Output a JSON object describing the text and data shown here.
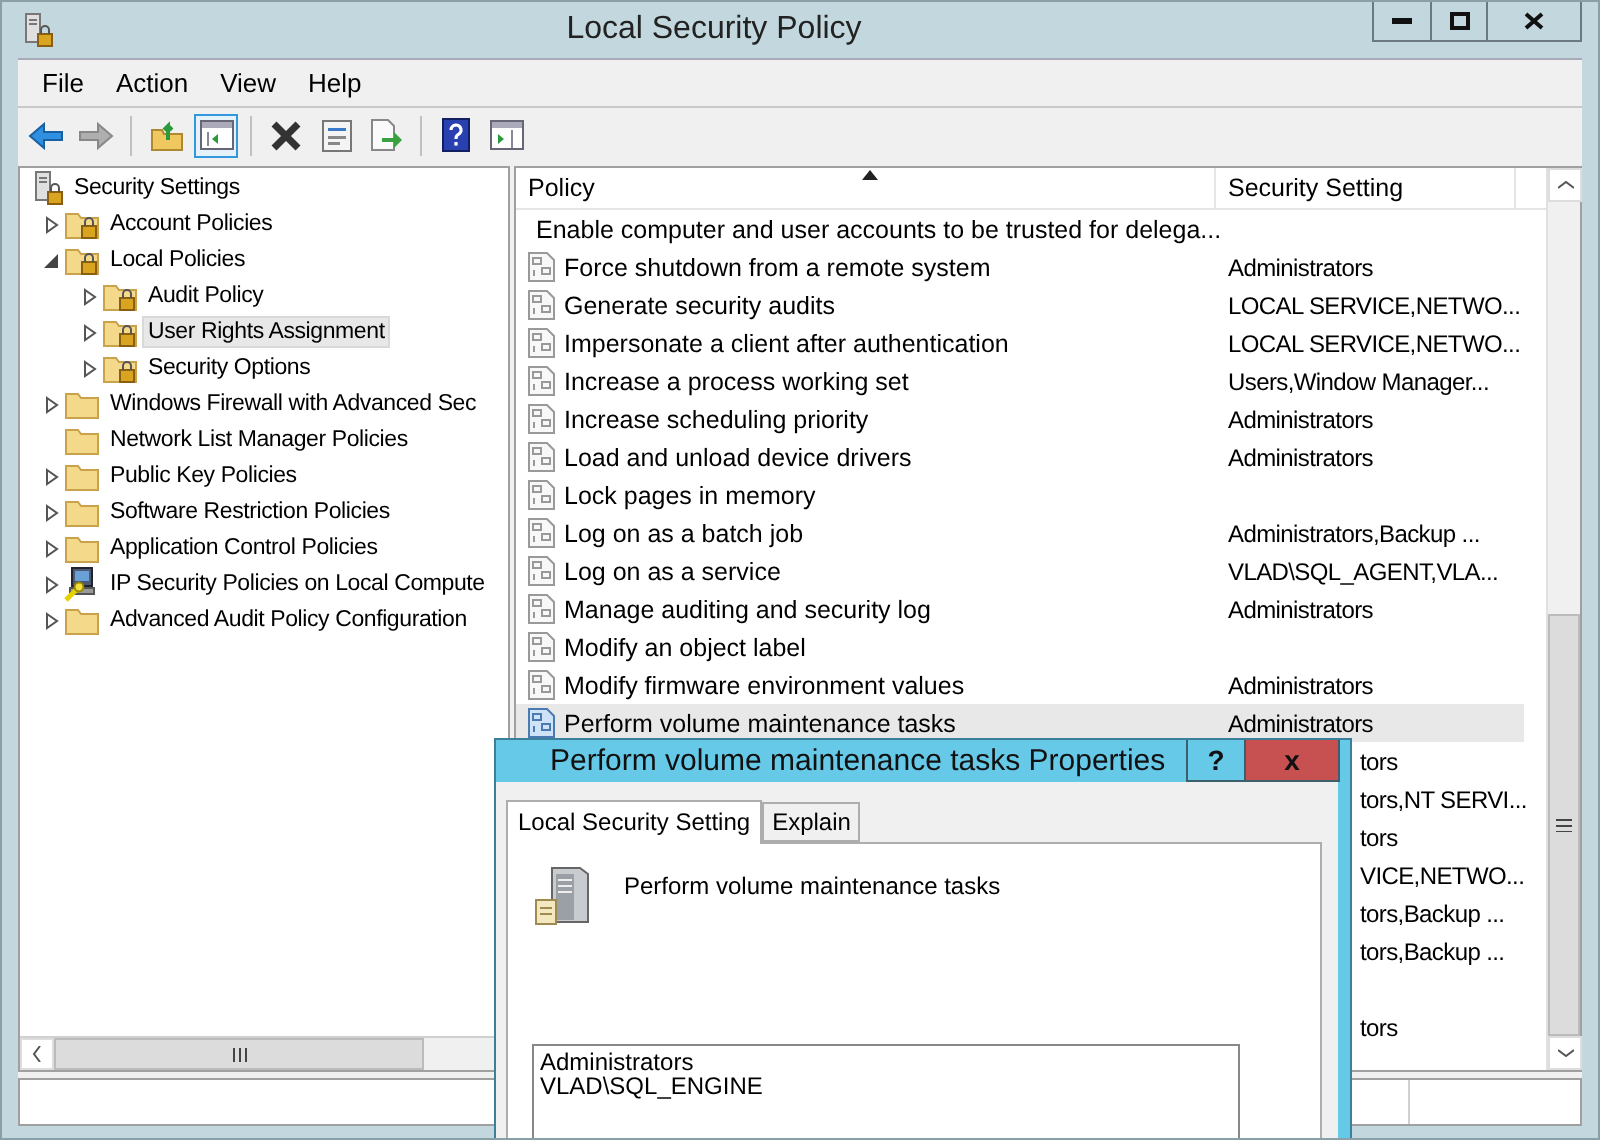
{
  "window": {
    "title": "Local Security Policy"
  },
  "menu": [
    "File",
    "Action",
    "View",
    "Help"
  ],
  "toolbar": [
    {
      "kind": "back",
      "disabled": false,
      "pressed": false
    },
    {
      "kind": "forward",
      "disabled": true,
      "pressed": false
    },
    {
      "kind": "sep"
    },
    {
      "kind": "up",
      "disabled": false,
      "pressed": false
    },
    {
      "kind": "tree",
      "disabled": false,
      "pressed": true
    },
    {
      "kind": "sep"
    },
    {
      "kind": "delete",
      "disabled": false,
      "pressed": false
    },
    {
      "kind": "properties",
      "disabled": false,
      "pressed": false
    },
    {
      "kind": "export",
      "disabled": false,
      "pressed": false
    },
    {
      "kind": "sep"
    },
    {
      "kind": "help",
      "disabled": false,
      "pressed": false
    },
    {
      "kind": "pane",
      "disabled": false,
      "pressed": false
    }
  ],
  "tree": {
    "label": "Security Settings",
    "kind": "security",
    "selected": false,
    "children": [
      {
        "label": "Account Policies",
        "kind": "locked",
        "expandable": true,
        "expanded": false,
        "selected": false
      },
      {
        "label": "Local Policies",
        "kind": "locked",
        "expandable": true,
        "expanded": true,
        "selected": false,
        "children": [
          {
            "label": "Audit Policy",
            "kind": "locked",
            "expandable": true,
            "expanded": false,
            "selected": false
          },
          {
            "label": "User Rights Assignment",
            "kind": "locked",
            "expandable": true,
            "expanded": false,
            "selected": true
          },
          {
            "label": "Security Options",
            "kind": "locked",
            "expandable": true,
            "expanded": false,
            "selected": false
          }
        ]
      },
      {
        "label": "Windows Firewall with Advanced Sec",
        "kind": "plain",
        "expandable": true,
        "expanded": false,
        "selected": false
      },
      {
        "label": "Network List Manager Policies",
        "kind": "plain",
        "expandable": false,
        "selected": false
      },
      {
        "label": "Public Key Policies",
        "kind": "plain",
        "expandable": true,
        "expanded": false,
        "selected": false
      },
      {
        "label": "Software Restriction Policies",
        "kind": "plain",
        "expandable": true,
        "expanded": false,
        "selected": false
      },
      {
        "label": "Application Control Policies",
        "kind": "plain",
        "expandable": true,
        "expanded": false,
        "selected": false
      },
      {
        "label": "IP Security Policies on Local Compute",
        "kind": "ipsec",
        "expandable": true,
        "expanded": false,
        "selected": false
      },
      {
        "label": "Advanced Audit Policy Configuration",
        "kind": "plain",
        "expandable": true,
        "expanded": false,
        "selected": false
      }
    ]
  },
  "table": {
    "columns": [
      "Policy",
      "Security Setting"
    ],
    "rows": [
      {
        "kind": "full",
        "policy": "Enable computer and user accounts to be trusted for delega...",
        "selected": false
      },
      {
        "kind": "full",
        "policy": "Force shutdown from a remote system",
        "setting": "Administrators",
        "selected": false
      },
      {
        "kind": "full",
        "policy": "Generate security audits",
        "setting": "LOCAL SERVICE,NETWO...",
        "selected": false
      },
      {
        "kind": "full",
        "policy": "Impersonate a client after authentication",
        "setting": "LOCAL SERVICE,NETWO...",
        "selected": false
      },
      {
        "kind": "full",
        "policy": "Increase a process working set",
        "setting": "Users,Window Manager...",
        "selected": false
      },
      {
        "kind": "full",
        "policy": "Increase scheduling priority",
        "setting": "Administrators",
        "selected": false
      },
      {
        "kind": "full",
        "policy": "Load and unload device drivers",
        "setting": "Administrators",
        "selected": false
      },
      {
        "kind": "full",
        "policy": "Lock pages in memory",
        "selected": false
      },
      {
        "kind": "full",
        "policy": "Log on as a batch job",
        "setting": "Administrators,Backup ...",
        "selected": false
      },
      {
        "kind": "full",
        "policy": "Log on as a service",
        "setting": "VLAD\\SQL_AGENT,VLA...",
        "selected": false
      },
      {
        "kind": "full",
        "policy": "Manage auditing and security log",
        "setting": "Administrators",
        "selected": false
      },
      {
        "kind": "full",
        "policy": "Modify an object label",
        "selected": false
      },
      {
        "kind": "full",
        "policy": "Modify firmware environment values",
        "setting": "Administrators",
        "selected": false
      },
      {
        "kind": "full",
        "policy": "Perform volume maintenance tasks",
        "setting": "Administrators",
        "selected": true
      },
      {
        "kind": "partial",
        "setting": "tors"
      },
      {
        "kind": "partial",
        "setting": "tors,NT SERVI..."
      },
      {
        "kind": "partial",
        "setting": "tors"
      },
      {
        "kind": "partial",
        "setting": "VICE,NETWO..."
      },
      {
        "kind": "partial",
        "setting": "tors,Backup ..."
      },
      {
        "kind": "partial",
        "setting": "tors,Backup ..."
      },
      {
        "kind": "partial"
      },
      {
        "kind": "partial",
        "setting": "tors"
      }
    ]
  },
  "dialog": {
    "title": "Perform volume maintenance tasks Properties",
    "help_button": "?",
    "close_button": "x",
    "tabs": [
      {
        "label": "Local Security Setting",
        "selected": true
      },
      {
        "label": "Explain",
        "selected": false
      }
    ],
    "policy_name": "Perform volume maintenance tasks",
    "members": [
      "Administrators",
      "VLAD\\SQL_ENGINE"
    ]
  }
}
